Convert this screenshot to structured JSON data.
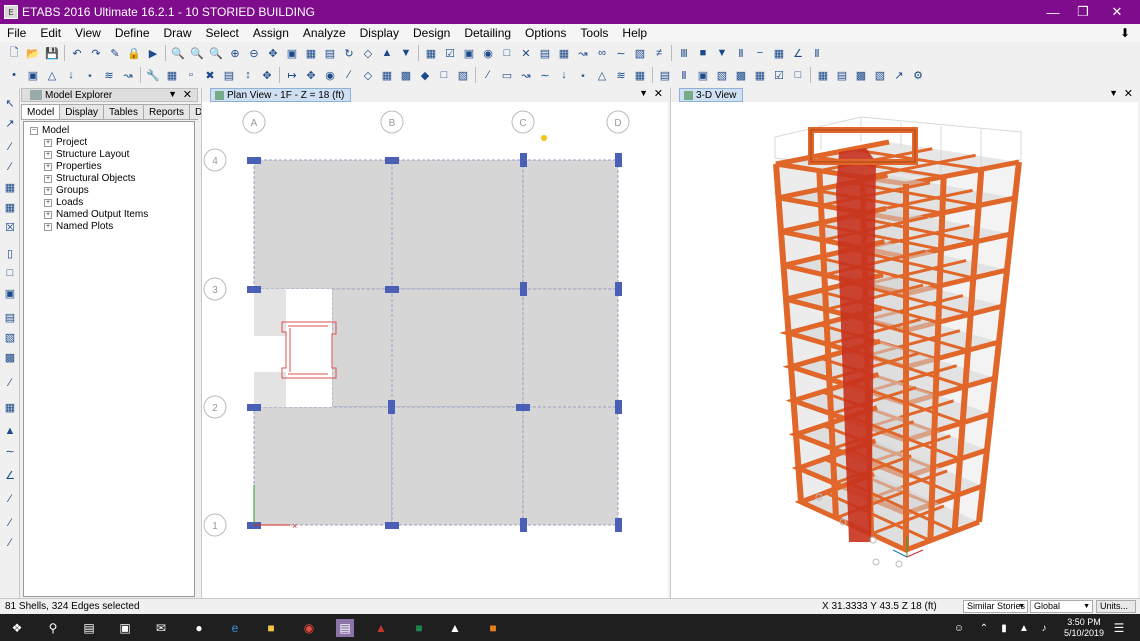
{
  "window": {
    "title": "ETABS 2016 Ultimate 16.2.1 - 10 STORIED BUILDING",
    "app_icon": "etabs-icon"
  },
  "menu": [
    "File",
    "Edit",
    "View",
    "Define",
    "Draw",
    "Select",
    "Assign",
    "Analyze",
    "Display",
    "Design",
    "Detailing",
    "Options",
    "Tools",
    "Help"
  ],
  "explorer": {
    "title": "Model Explorer",
    "tabs": [
      "Model",
      "Display",
      "Tables",
      "Reports",
      "Detailing"
    ],
    "root": "Model",
    "items": [
      "Project",
      "Structure Layout",
      "Properties",
      "Structural Objects",
      "Groups",
      "Loads",
      "Named Output Items",
      "Named Plots"
    ]
  },
  "plan_view": {
    "tab_title": "Plan View - 1F - Z = 18 (ft)",
    "col_labels": [
      "A",
      "B",
      "C",
      "D"
    ],
    "row_labels": [
      "4",
      "3",
      "2",
      "1"
    ]
  },
  "view_3d": {
    "tab_title": "3-D View"
  },
  "status": {
    "selection": "81 Shells, 324 Edges selected",
    "coords": "X 31.3333  Y 43.5  Z 18 (ft)",
    "stories_select": "Similar Stories",
    "coord_sys_select": "Global",
    "units_button": "Units..."
  },
  "taskbar": {
    "time": "3:50 PM",
    "date": "5/10/2019"
  },
  "colors": {
    "titlebar": "#7f0c8c",
    "beam": "#e0662a",
    "core": "#c8321e",
    "slab": "#d4d4d4",
    "column_marker": "#4a5fb5"
  }
}
